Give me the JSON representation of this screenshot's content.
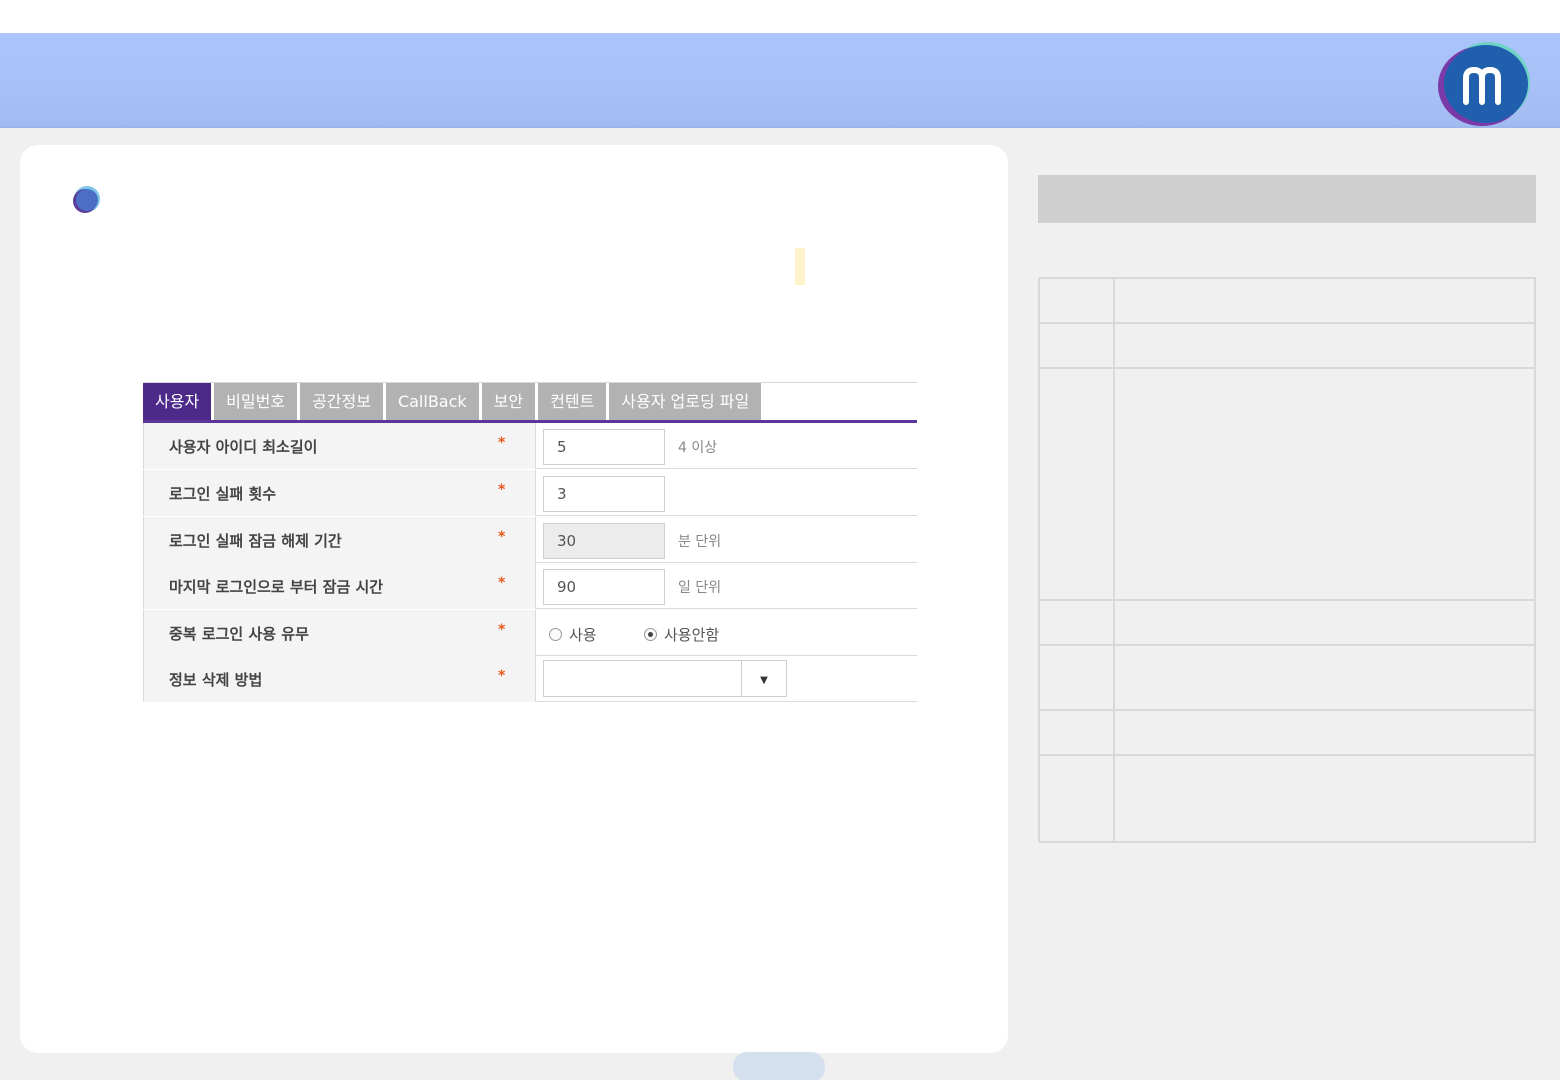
{
  "colors": {
    "header": "#a8c1f7",
    "tab_active": "#4d2a8a",
    "tab_inactive": "#b2b2b2",
    "required": "#e5591c"
  },
  "logo": {
    "icon": "m-logo-icon"
  },
  "settings": {
    "tabs": [
      "사용자",
      "비밀번호",
      "공간정보",
      "CallBack",
      "보안",
      "컨텐트",
      "사용자 업로딩 파일"
    ],
    "active_tab": "사용자",
    "required_mark": "*",
    "rows": [
      {
        "label": "사용자 아이디 최소길이",
        "value": "5",
        "hint": "4 이상"
      },
      {
        "label": "로그인 실패 횟수",
        "value": "3"
      },
      {
        "label": "로그인 실패 잠금 해제 기간",
        "value": "30",
        "hint": "분 단위"
      },
      {
        "label": "마지막 로그인으로 부터 잠금 시간",
        "value": "90",
        "hint": "일 단위"
      },
      {
        "label": "중복 로그인 사용 유무",
        "options": [
          "사용",
          "사용안함"
        ],
        "selected": "사용안함"
      },
      {
        "label": "정보 삭제 방법",
        "select_value": ""
      }
    ]
  }
}
